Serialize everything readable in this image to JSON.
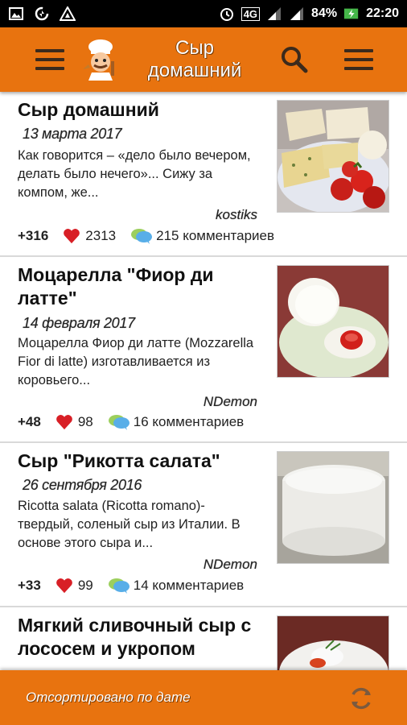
{
  "status_bar": {
    "battery": "84%",
    "time": "22:20",
    "network": "4G",
    "icons": [
      "image-icon",
      "data-saver-icon",
      "warning-icon",
      "alarm-icon",
      "signal-icon",
      "battery-icon"
    ]
  },
  "app_bar": {
    "title": "Сыр домашний",
    "icons": [
      "menu-icon",
      "chef-logo",
      "search-icon",
      "overflow-menu-icon"
    ],
    "accent_color": "#e8730f"
  },
  "recipes": [
    {
      "title": "Сыр домашний",
      "date": "13 марта 2017",
      "description": "Как говорится – «дело было вечером, делать было нечего»... Сижу за компом, же...",
      "author": "kostiks",
      "rating": "+316",
      "likes": "2313",
      "comments": "215 комментариев"
    },
    {
      "title": "Моцарелла \"Фиор ди латте\"",
      "date": "14 февраля 2017",
      "description": "Моцарелла Фиор ди латте (Mozzarella Fior di latte) изготавливается из коровьего...",
      "author": "NDemon",
      "rating": "+48",
      "likes": "98",
      "comments": "16 комментариев"
    },
    {
      "title": "Сыр \"Рикотта салата\"",
      "date": "26 сентября 2016",
      "description": "Ricotta salata (Ricotta romano)- твердый, соленый сыр из Италии. В основе этого сыра и...",
      "author": "NDemon",
      "rating": "+33",
      "likes": "99",
      "comments": "14 комментариев"
    },
    {
      "title": "Мягкий сливочный сыр с лососем и укропом",
      "date": "",
      "description": "",
      "author": "",
      "rating": "",
      "likes": "",
      "comments": ""
    }
  ],
  "bottom_bar": {
    "sort_label": "Отсортировано по дате"
  }
}
